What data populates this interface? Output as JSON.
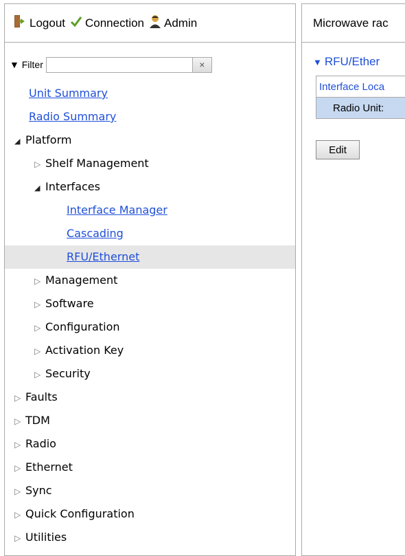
{
  "toolbar": {
    "logout_label": "Logout",
    "connection_label": "Connection",
    "admin_label": "Admin"
  },
  "filter": {
    "label": "Filter",
    "value": "",
    "clear_glyph": "×"
  },
  "tree": {
    "unit_summary": "Unit Summary",
    "radio_summary": "Radio Summary",
    "platform": "Platform",
    "shelf_management": "Shelf Management",
    "interfaces": "Interfaces",
    "interface_manager": "Interface Manager",
    "cascading": "Cascading",
    "rfu_ethernet": "RFU/Ethernet",
    "management": "Management",
    "software": "Software",
    "configuration": "Configuration",
    "activation_key": "Activation Key",
    "security": "Security",
    "faults": "Faults",
    "tdm": "TDM",
    "radio": "Radio",
    "ethernet": "Ethernet",
    "sync": "Sync",
    "quick_configuration": "Quick Configuration",
    "utilities": "Utilities"
  },
  "main": {
    "title": "Microwave rac",
    "section_title": "RFU/Ether",
    "table_header": "Interface Loca",
    "table_row": "Radio Unit:",
    "edit_label": "Edit"
  },
  "colors": {
    "link": "#1f4fd8",
    "selected_row": "#e6e6e6",
    "table_row_bg": "#c7d9f1"
  }
}
